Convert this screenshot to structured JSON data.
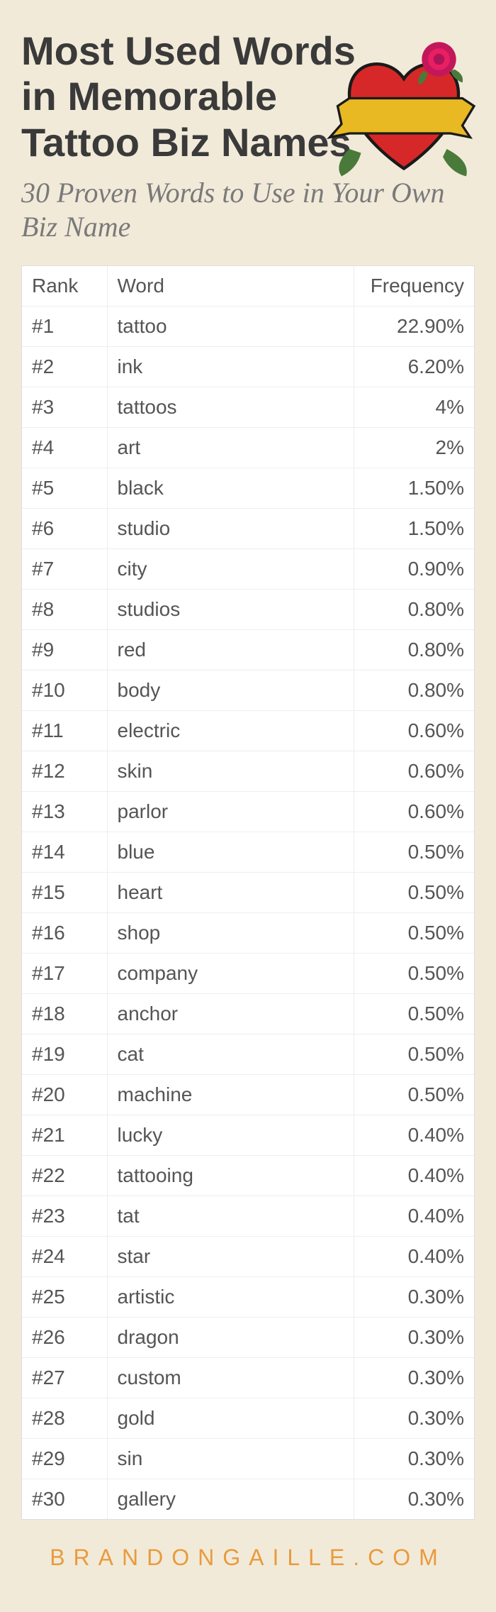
{
  "title": "Most Used Words in Memorable Tattoo Biz Names",
  "subtitle": "30 Proven Words to Use in Your Own Biz Name",
  "columns": {
    "rank": "Rank",
    "word": "Word",
    "frequency": "Frequency"
  },
  "rows": [
    {
      "rank": "#1",
      "word": "tattoo",
      "frequency": "22.90%"
    },
    {
      "rank": "#2",
      "word": "ink",
      "frequency": "6.20%"
    },
    {
      "rank": "#3",
      "word": "tattoos",
      "frequency": "4%"
    },
    {
      "rank": "#4",
      "word": "art",
      "frequency": "2%"
    },
    {
      "rank": "#5",
      "word": "black",
      "frequency": "1.50%"
    },
    {
      "rank": "#6",
      "word": "studio",
      "frequency": "1.50%"
    },
    {
      "rank": "#7",
      "word": "city",
      "frequency": "0.90%"
    },
    {
      "rank": "#8",
      "word": "studios",
      "frequency": "0.80%"
    },
    {
      "rank": "#9",
      "word": "red",
      "frequency": "0.80%"
    },
    {
      "rank": "#10",
      "word": "body",
      "frequency": "0.80%"
    },
    {
      "rank": "#11",
      "word": "electric",
      "frequency": "0.60%"
    },
    {
      "rank": "#12",
      "word": "skin",
      "frequency": "0.60%"
    },
    {
      "rank": "#13",
      "word": "parlor",
      "frequency": "0.60%"
    },
    {
      "rank": "#14",
      "word": "blue",
      "frequency": "0.50%"
    },
    {
      "rank": "#15",
      "word": "heart",
      "frequency": "0.50%"
    },
    {
      "rank": "#16",
      "word": "shop",
      "frequency": "0.50%"
    },
    {
      "rank": "#17",
      "word": "company",
      "frequency": "0.50%"
    },
    {
      "rank": "#18",
      "word": "anchor",
      "frequency": "0.50%"
    },
    {
      "rank": "#19",
      "word": "cat",
      "frequency": "0.50%"
    },
    {
      "rank": "#20",
      "word": "machine",
      "frequency": "0.50%"
    },
    {
      "rank": "#21",
      "word": "lucky",
      "frequency": "0.40%"
    },
    {
      "rank": "#22",
      "word": "tattooing",
      "frequency": "0.40%"
    },
    {
      "rank": "#23",
      "word": "tat",
      "frequency": "0.40%"
    },
    {
      "rank": "#24",
      "word": "star",
      "frequency": "0.40%"
    },
    {
      "rank": "#25",
      "word": "artistic",
      "frequency": "0.30%"
    },
    {
      "rank": "#26",
      "word": "dragon",
      "frequency": "0.30%"
    },
    {
      "rank": "#27",
      "word": "custom",
      "frequency": "0.30%"
    },
    {
      "rank": "#28",
      "word": "gold",
      "frequency": "0.30%"
    },
    {
      "rank": "#29",
      "word": "sin",
      "frequency": "0.30%"
    },
    {
      "rank": "#30",
      "word": "gallery",
      "frequency": "0.30%"
    }
  ],
  "footer": "BRANDONGAILLE.COM",
  "chart_data": {
    "type": "table",
    "title": "Most Used Words in Memorable Tattoo Biz Names",
    "columns": [
      "Rank",
      "Word",
      "Frequency"
    ],
    "rows": [
      [
        1,
        "tattoo",
        22.9
      ],
      [
        2,
        "ink",
        6.2
      ],
      [
        3,
        "tattoos",
        4.0
      ],
      [
        4,
        "art",
        2.0
      ],
      [
        5,
        "black",
        1.5
      ],
      [
        6,
        "studio",
        1.5
      ],
      [
        7,
        "city",
        0.9
      ],
      [
        8,
        "studios",
        0.8
      ],
      [
        9,
        "red",
        0.8
      ],
      [
        10,
        "body",
        0.8
      ],
      [
        11,
        "electric",
        0.6
      ],
      [
        12,
        "skin",
        0.6
      ],
      [
        13,
        "parlor",
        0.6
      ],
      [
        14,
        "blue",
        0.5
      ],
      [
        15,
        "heart",
        0.5
      ],
      [
        16,
        "shop",
        0.5
      ],
      [
        17,
        "company",
        0.5
      ],
      [
        18,
        "anchor",
        0.5
      ],
      [
        19,
        "cat",
        0.5
      ],
      [
        20,
        "machine",
        0.5
      ],
      [
        21,
        "lucky",
        0.4
      ],
      [
        22,
        "tattooing",
        0.4
      ],
      [
        23,
        "tat",
        0.4
      ],
      [
        24,
        "star",
        0.4
      ],
      [
        25,
        "artistic",
        0.3
      ],
      [
        26,
        "dragon",
        0.3
      ],
      [
        27,
        "custom",
        0.3
      ],
      [
        28,
        "gold",
        0.3
      ],
      [
        29,
        "sin",
        0.3
      ],
      [
        30,
        "gallery",
        0.3
      ]
    ]
  }
}
